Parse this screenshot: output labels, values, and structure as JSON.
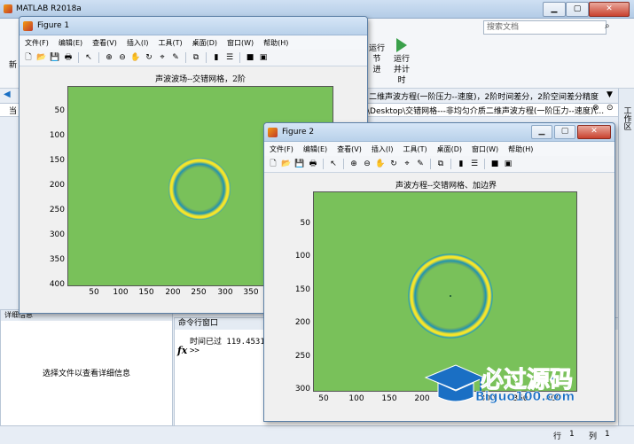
{
  "main_window": {
    "title": "MATLAB R2018a",
    "left_clip": "新",
    "left_tab": "当",
    "search_placeholder": "搜索文档",
    "toolbar_btn1_line1": "运行节",
    "toolbar_btn1_line2": "进",
    "toolbar_btn2": "运行并计时",
    "editor_tab": "二维声波方程(一阶压力--速度)，2阶时间差分，2阶空间差分精度",
    "path_text": "\\Desktop\\交错网格---非均匀介质二维声波方程(一阶压力--速度)\\...",
    "right_panel_label": "工作区",
    "details_panel_title": "详细信息",
    "details_panel_text": "选择文件以查看详细信息",
    "cmd_panel_title": "命令行窗口",
    "cmd_output": "时间已过 119.45317",
    "cmd_prompt": ">>",
    "fx": "fx",
    "status_row_label": "行",
    "status_row": "1",
    "status_col_label": "列",
    "status_col": "1"
  },
  "figure1": {
    "title": "Figure 1",
    "menu": [
      "文件(F)",
      "编辑(E)",
      "查看(V)",
      "插入(I)",
      "工具(T)",
      "桌面(D)",
      "窗口(W)",
      "帮助(H)"
    ],
    "plot_title": "声波波场--交错网格，2阶",
    "y_ticks": [
      "50",
      "100",
      "150",
      "200",
      "250",
      "300",
      "350",
      "400"
    ],
    "x_ticks": [
      "50",
      "100",
      "150",
      "200",
      "250",
      "300",
      "350"
    ]
  },
  "figure2": {
    "title": "Figure 2",
    "menu": [
      "文件(F)",
      "编辑(E)",
      "查看(V)",
      "插入(I)",
      "工具(T)",
      "桌面(D)",
      "窗口(W)",
      "帮助(H)"
    ],
    "plot_title": "声波方程--交错网格、加边界",
    "y_ticks": [
      "50",
      "100",
      "150",
      "200",
      "250",
      "300"
    ],
    "x_ticks": [
      "50",
      "100",
      "150",
      "200",
      "250",
      "300",
      "350",
      "400"
    ]
  },
  "watermark": {
    "cn": "必过源码",
    "en": "Biguo100.com"
  },
  "colors": {
    "field": "#79c15a",
    "ring_yellow": "#f5e52a",
    "ring_cyan": "#21a5b5",
    "accent_blue": "#1a6fc4"
  }
}
